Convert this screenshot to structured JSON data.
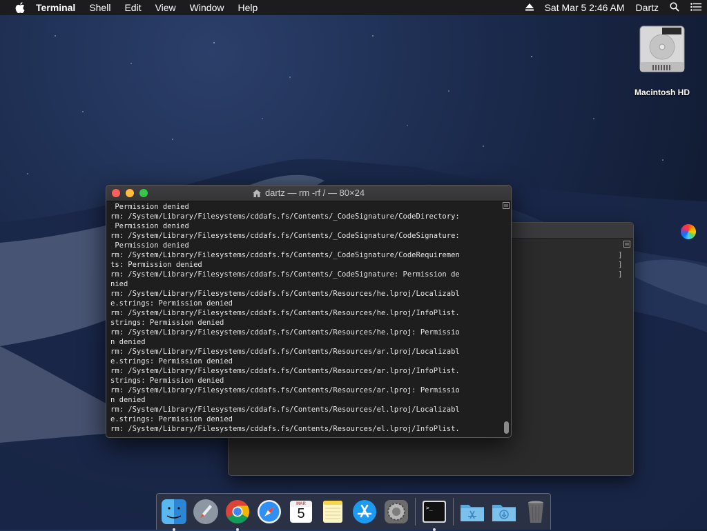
{
  "menubar": {
    "app_name": "Terminal",
    "items": [
      "Shell",
      "Edit",
      "View",
      "Window",
      "Help"
    ],
    "datetime": "Sat Mar 5  2:46 AM",
    "user": "Dartz"
  },
  "desktop": {
    "drive_label": "Macintosh HD"
  },
  "terminal": {
    "title": "dartz — rm -rf / — 80×24",
    "lines": [
      " Permission denied",
      "rm: /System/Library/Filesystems/cddafs.fs/Contents/_CodeSignature/CodeDirectory:",
      " Permission denied",
      "rm: /System/Library/Filesystems/cddafs.fs/Contents/_CodeSignature/CodeSignature:",
      " Permission denied",
      "rm: /System/Library/Filesystems/cddafs.fs/Contents/_CodeSignature/CodeRequiremen",
      "ts: Permission denied",
      "rm: /System/Library/Filesystems/cddafs.fs/Contents/_CodeSignature: Permission de",
      "nied",
      "rm: /System/Library/Filesystems/cddafs.fs/Contents/Resources/he.lproj/Localizabl",
      "e.strings: Permission denied",
      "rm: /System/Library/Filesystems/cddafs.fs/Contents/Resources/he.lproj/InfoPlist.",
      "strings: Permission denied",
      "rm: /System/Library/Filesystems/cddafs.fs/Contents/Resources/he.lproj: Permissio",
      "n denied",
      "rm: /System/Library/Filesystems/cddafs.fs/Contents/Resources/ar.lproj/Localizabl",
      "e.strings: Permission denied",
      "rm: /System/Library/Filesystems/cddafs.fs/Contents/Resources/ar.lproj/InfoPlist.",
      "strings: Permission denied",
      "rm: /System/Library/Filesystems/cddafs.fs/Contents/Resources/ar.lproj: Permissio",
      "n denied",
      "rm: /System/Library/Filesystems/cddafs.fs/Contents/Resources/el.lproj/Localizabl",
      "e.strings: Permission denied",
      "rm: /System/Library/Filesystems/cddafs.fs/Contents/Resources/el.lproj/InfoPlist."
    ]
  },
  "back_window": {
    "brackets": [
      "]",
      "]",
      "]"
    ]
  },
  "calendar": {
    "month": "MAR",
    "day": "5"
  },
  "dock": {
    "apps": [
      "finder-icon",
      "launchpad-icon",
      "chrome-icon",
      "safari-icon",
      "calendar-icon",
      "notes-icon",
      "app-store-icon",
      "system-preferences-icon",
      "terminal-icon",
      "applications-folder-icon",
      "downloads-folder-icon",
      "trash-icon"
    ]
  },
  "colors": {
    "menubar_bg": "#1c1c1e",
    "terminal_bg": "#1e1e1e",
    "close": "#fc605c",
    "minimize": "#fdbc40",
    "maximize": "#34c749"
  }
}
